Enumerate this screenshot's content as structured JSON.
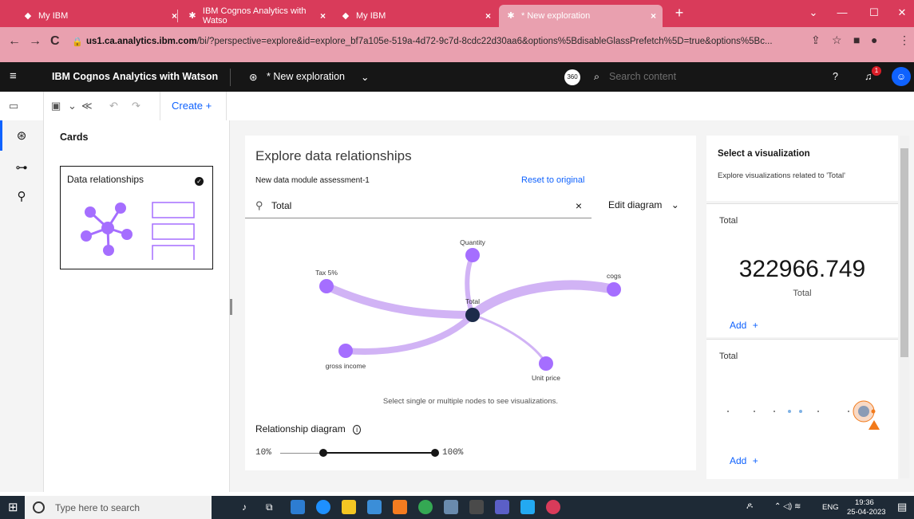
{
  "browser": {
    "tabs": [
      {
        "label": "My IBM"
      },
      {
        "label": "IBM Cognos Analytics with Watso"
      },
      {
        "label": "My IBM"
      },
      {
        "label": "* New exploration"
      }
    ],
    "new_tab": "+",
    "url_domain": "us1.ca.analytics.ibm.com",
    "url_path": "/bi/?perspective=explore&id=explore_bf7a105e-519a-4d72-9c7d-8cdc22d30aa6&options%5BdisableGlassPrefetch%5D=true&options%5Bc..."
  },
  "app": {
    "title": "IBM Cognos Analytics with Watson",
    "exploration": "* New exploration",
    "badge": "360",
    "search_placeholder": "Search content",
    "notif_count": "1"
  },
  "toolbar": {
    "create_label": "Create",
    "create_plus": "+"
  },
  "cards_panel": {
    "title": "Cards",
    "card_label": "Data relationships"
  },
  "explore": {
    "heading": "Explore data relationships",
    "module": "New data module assessment-1",
    "reset": "Reset to original",
    "search_value": "Total",
    "edit_diagram": "Edit diagram",
    "nodes": {
      "quantity": "Quantity",
      "tax": "Tax 5%",
      "cogs": "cogs",
      "total": "Total",
      "gross_income": "gross income",
      "unit_price": "Unit price"
    },
    "hint": "Select single or multiple nodes to see visualizations.",
    "rel_label": "Relationship diagram",
    "slider_min": "10%",
    "slider_max": "100%"
  },
  "viz_panel": {
    "title": "Select a visualization",
    "subtitle": "Explore visualizations related to 'Total'",
    "card1_title": "Total",
    "card1_value": "322966.749",
    "card1_sub": "Total",
    "card1_add": "Add",
    "card2_title": "Total",
    "card2_add": "Add",
    "add_plus": "+"
  },
  "taskbar": {
    "search_placeholder": "Type here to search",
    "lang": "ENG",
    "time": "19:36",
    "date": "25-04-2023"
  },
  "colors": {
    "accent": "#0f62fe",
    "node": "#a56eff",
    "edge": "#d1b3f5",
    "selected_node": "#1c2b4a",
    "tab_strip": "#d93b5a"
  }
}
